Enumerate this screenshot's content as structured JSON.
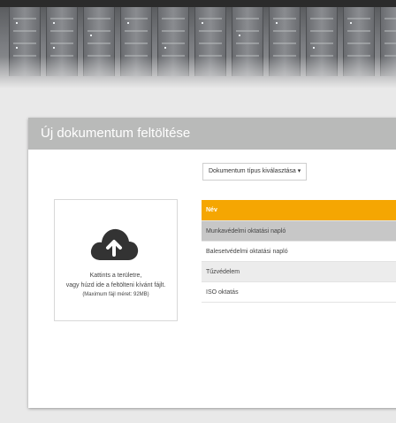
{
  "header": {
    "title": "Új dokumentum feltöltése"
  },
  "doc_type_select": {
    "label": "Dokumentum típus kiválasztása ▾"
  },
  "dropzone": {
    "line1": "Kattints a területre,",
    "line2": "vagy húzd ide a feltölteni kívánt fájlt.",
    "line3": "(Maximum fájl méret: 92MB)"
  },
  "table": {
    "column": "Név",
    "rows": [
      "Munkavédelmi oktatási napló",
      "Balesetvédelmi oktatási napló",
      "Tűzvédelem",
      "ISO oktatás"
    ]
  },
  "colors": {
    "accent": "#f5a602",
    "header_bg": "#b9bab9",
    "page_bg": "#e9e9e9"
  },
  "icons": {
    "upload": "cloud-upload-icon"
  }
}
